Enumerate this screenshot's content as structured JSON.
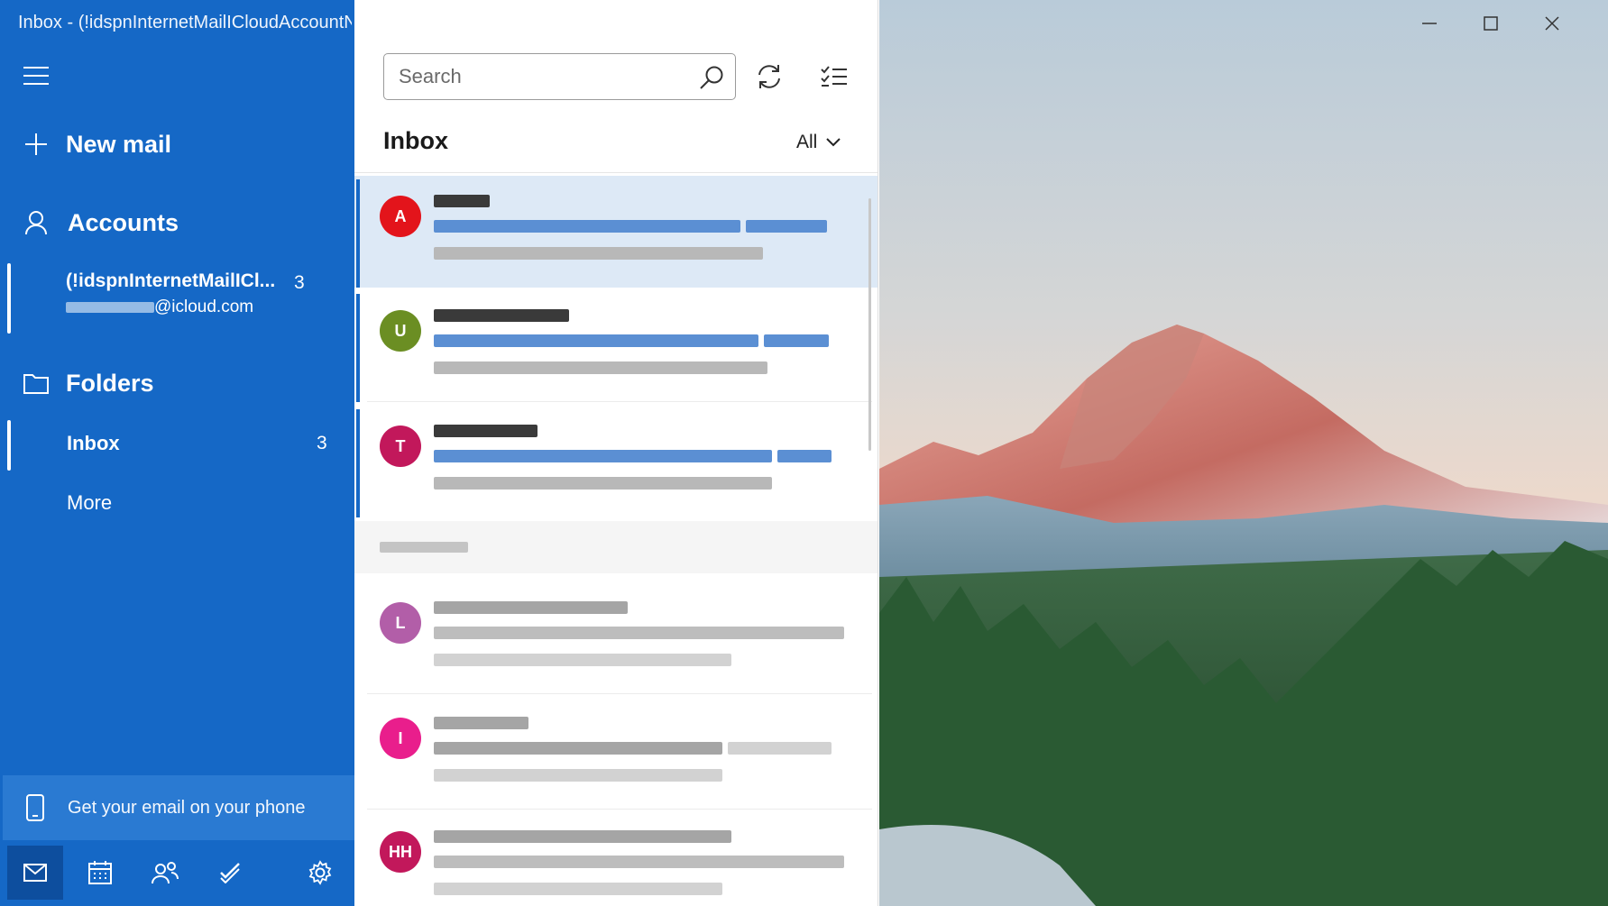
{
  "window": {
    "title": "Inbox - (!idspnInternetMailICloudAccountN"
  },
  "sidebar": {
    "new_mail": "New mail",
    "accounts_label": "Accounts",
    "account": {
      "name": "(!idspnInternetMailICl...",
      "count": "3",
      "email_domain": "@icloud.com"
    },
    "folders_label": "Folders",
    "folders": [
      {
        "label": "Inbox",
        "count": "3"
      }
    ],
    "more": "More",
    "phone_promo": "Get your email on your phone",
    "bottom_nav": [
      "mail-icon",
      "calendar-icon",
      "people-icon",
      "todo-icon",
      "settings-icon"
    ]
  },
  "list": {
    "search_placeholder": "Search",
    "title": "Inbox",
    "filter": "All",
    "messages": [
      {
        "initial": "A",
        "color": "#e3141b",
        "selected": true,
        "unread": true
      },
      {
        "initial": "U",
        "color": "#6b8e23",
        "selected": false,
        "unread": true
      },
      {
        "initial": "T",
        "color": "#c2185b",
        "selected": false,
        "unread": true
      },
      {
        "initial": "L",
        "color": "#b25ea8",
        "selected": false,
        "unread": false
      },
      {
        "initial": "I",
        "color": "#e91e8c",
        "selected": false,
        "unread": false
      },
      {
        "initial": "HH",
        "color": "#c2185b",
        "selected": false,
        "unread": false
      }
    ]
  },
  "colors": {
    "accent": "#1568c6",
    "unread_subject": "#1a66c4"
  }
}
